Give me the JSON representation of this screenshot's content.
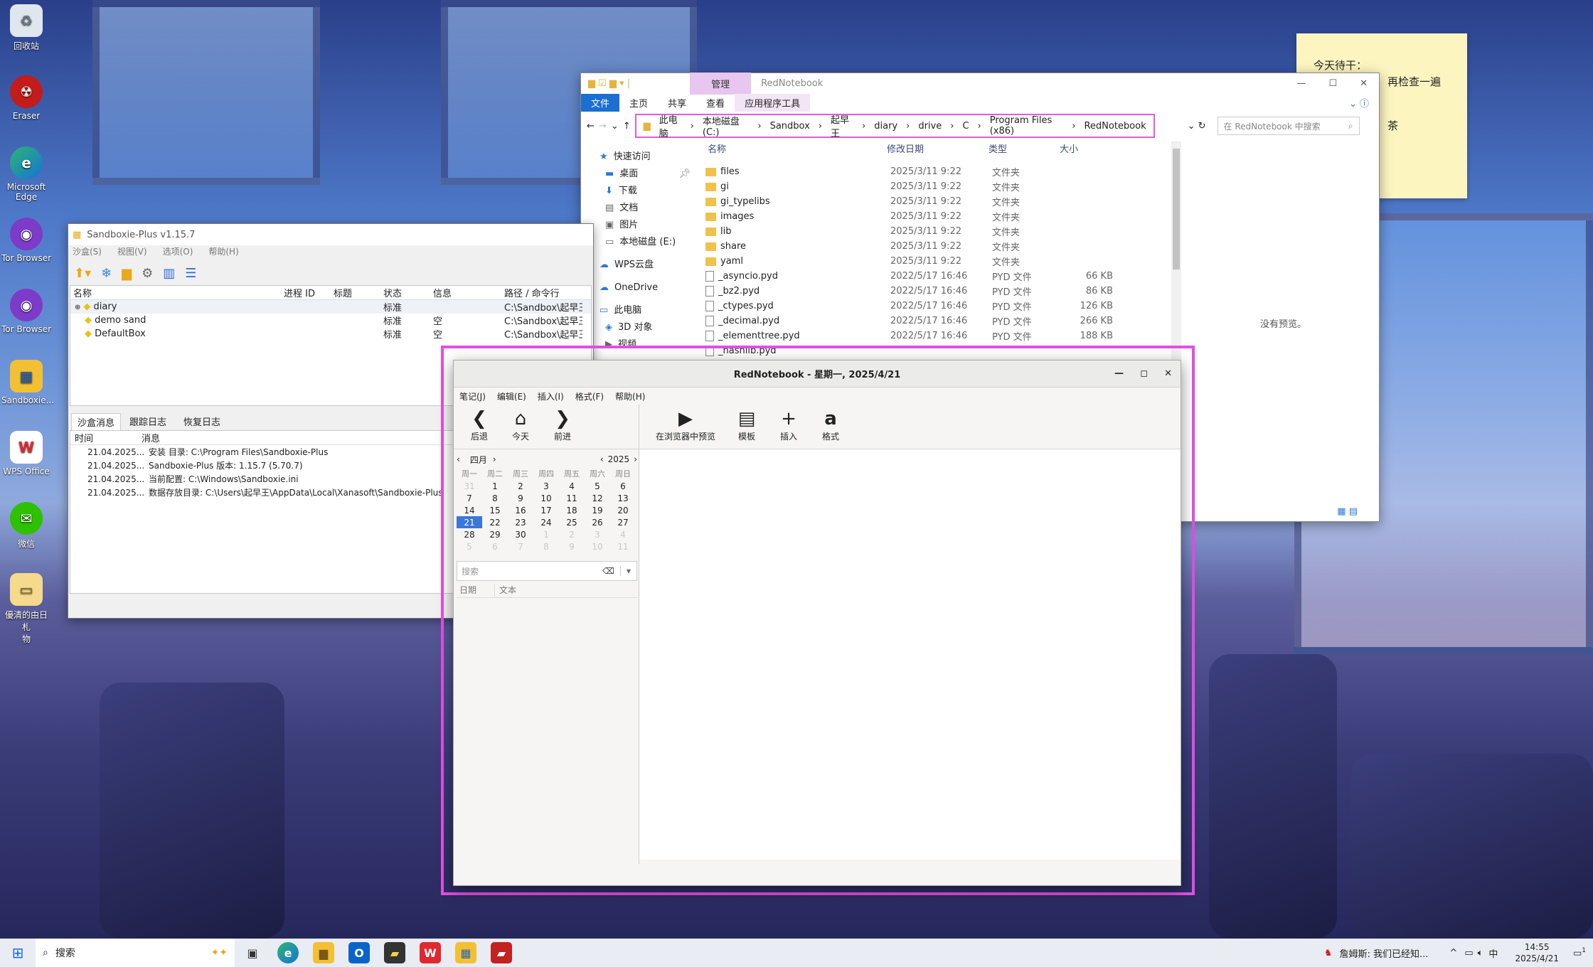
{
  "desktop": {
    "icons": [
      {
        "label": "回收站",
        "icon": "recycle-bin-icon"
      },
      {
        "label": "Eraser",
        "icon": "eraser-icon"
      },
      {
        "label": "Microsoft Edge",
        "icon": "edge-icon"
      },
      {
        "label": "Tor Browser",
        "icon": "tor-browser-icon"
      },
      {
        "label": "Tor Browser",
        "icon": "tor-browser-icon"
      },
      {
        "label": "Sandboxie...",
        "icon": "sandboxie-icon"
      },
      {
        "label": "WPS Office",
        "icon": "wps-office-icon"
      },
      {
        "label": "微信",
        "icon": "wechat-icon"
      },
      {
        "label": "優清的由日札\n物",
        "icon": "folder-icon"
      }
    ]
  },
  "sticky": {
    "lines": [
      "今天待干：",
      "再检查一遍",
      "",
      "茶"
    ]
  },
  "explorer": {
    "ribbon_tools": "管理",
    "title": "RedNotebook",
    "tabs": [
      "文件",
      "主页",
      "共享",
      "查看",
      "应用程序工具"
    ],
    "breadcrumb": [
      "此电脑",
      "本地磁盘 (C:)",
      "Sandbox",
      "起早王",
      "diary",
      "drive",
      "C",
      "Program Files (x86)",
      "RedNotebook"
    ],
    "search_placeholder": "在 RedNotebook 中搜索",
    "nav": [
      "快速访问",
      "桌面",
      "下载",
      "文档",
      "图片",
      "本地磁盘 (E:)",
      "WPS云盘",
      "OneDrive",
      "此电脑",
      "3D 对象",
      "视频"
    ],
    "columns": [
      "名称",
      "修改日期",
      "类型",
      "大小"
    ],
    "files": [
      {
        "name": "files",
        "date": "2025/3/11 9:22",
        "type": "文件夹",
        "size": "",
        "kind": "folder"
      },
      {
        "name": "gi",
        "date": "2025/3/11 9:22",
        "type": "文件夹",
        "size": "",
        "kind": "folder"
      },
      {
        "name": "gi_typelibs",
        "date": "2025/3/11 9:22",
        "type": "文件夹",
        "size": "",
        "kind": "folder"
      },
      {
        "name": "images",
        "date": "2025/3/11 9:22",
        "type": "文件夹",
        "size": "",
        "kind": "folder"
      },
      {
        "name": "lib",
        "date": "2025/3/11 9:22",
        "type": "文件夹",
        "size": "",
        "kind": "folder"
      },
      {
        "name": "share",
        "date": "2025/3/11 9:22",
        "type": "文件夹",
        "size": "",
        "kind": "folder"
      },
      {
        "name": "yaml",
        "date": "2025/3/11 9:22",
        "type": "文件夹",
        "size": "",
        "kind": "folder"
      },
      {
        "name": "_asyncio.pyd",
        "date": "2022/5/17 16:46",
        "type": "PYD 文件",
        "size": "66 KB",
        "kind": "pyd"
      },
      {
        "name": "_bz2.pyd",
        "date": "2022/5/17 16:46",
        "type": "PYD 文件",
        "size": "86 KB",
        "kind": "pyd"
      },
      {
        "name": "_ctypes.pyd",
        "date": "2022/5/17 16:46",
        "type": "PYD 文件",
        "size": "126 KB",
        "kind": "pyd"
      },
      {
        "name": "_decimal.pyd",
        "date": "2022/5/17 16:46",
        "type": "PYD 文件",
        "size": "266 KB",
        "kind": "pyd"
      },
      {
        "name": "_elementtree.pyd",
        "date": "2022/5/17 16:46",
        "type": "PYD 文件",
        "size": "188 KB",
        "kind": "pyd"
      },
      {
        "name": "_hashlib.pyd",
        "date": "",
        "type": "",
        "size": "",
        "kind": "pyd"
      }
    ],
    "preview": "没有预览。"
  },
  "sandboxie": {
    "title": "Sandboxie-Plus v1.15.7",
    "menu": [
      "沙盒(S)",
      "视图(V)",
      "选项(O)",
      "帮助(H)"
    ],
    "columns": [
      "名称",
      "进程 ID",
      "标题",
      "状态",
      "信息",
      "路径 / 命令行"
    ],
    "boxes": [
      {
        "name": "diary",
        "status": "标准",
        "info": "",
        "path": "C:\\Sandbox\\起早王"
      },
      {
        "name": "demo sand",
        "status": "标准",
        "info": "空",
        "path": "C:\\Sandbox\\起早王"
      },
      {
        "name": "DefaultBox",
        "status": "标准",
        "info": "空",
        "path": "C:\\Sandbox\\起早王"
      }
    ],
    "log_tabs": [
      "沙盒消息",
      "跟踪日志",
      "恢复日志"
    ],
    "log_columns": [
      "时间",
      "消息"
    ],
    "log": [
      {
        "time": "21.04.2025...",
        "msg": "安装 目录: C:\\Program Files\\Sandboxie-Plus"
      },
      {
        "time": "21.04.2025...",
        "msg": "Sandboxie-Plus 版本: 1.15.7 (5.70.7)"
      },
      {
        "time": "21.04.2025...",
        "msg": "当前配置: C:\\Windows\\Sandboxie.ini"
      },
      {
        "time": "21.04.2025...",
        "msg": "数据存放目录: C:\\Users\\起早王\\AppData\\Local\\Xanasoft\\Sandboxie-Plus"
      }
    ]
  },
  "rednotebook": {
    "title": "RedNotebook - 星期一, 2025/4/21",
    "menu": [
      "笔记(J)",
      "编辑(E)",
      "插入(I)",
      "格式(F)",
      "帮助(H)"
    ],
    "toolbar": [
      {
        "glyph": "❮",
        "label": "后退",
        "icon": "back-icon"
      },
      {
        "glyph": "⌂",
        "label": "今天",
        "icon": "home-icon"
      },
      {
        "glyph": "❯",
        "label": "前进",
        "icon": "forward-icon"
      },
      {
        "glyph": "▶",
        "label": "在浏览器中预览",
        "icon": "preview-icon"
      },
      {
        "glyph": "▤",
        "label": "模板",
        "icon": "template-icon"
      },
      {
        "glyph": "+",
        "label": "插入",
        "icon": "insert-icon"
      },
      {
        "glyph": "a",
        "label": "格式",
        "icon": "format-icon"
      }
    ],
    "calendar": {
      "month": "四月",
      "year": "2025",
      "weekdays": [
        "周一",
        "周二",
        "周三",
        "周四",
        "周五",
        "周六",
        "周日"
      ],
      "weeks": [
        [
          "31",
          "1",
          "2",
          "3",
          "4",
          "5",
          "6"
        ],
        [
          "7",
          "8",
          "9",
          "10",
          "11",
          "12",
          "13"
        ],
        [
          "14",
          "15",
          "16",
          "17",
          "18",
          "19",
          "20"
        ],
        [
          "21",
          "22",
          "23",
          "24",
          "25",
          "26",
          "27"
        ],
        [
          "28",
          "29",
          "30",
          "1",
          "2",
          "3",
          "4"
        ],
        [
          "5",
          "6",
          "7",
          "8",
          "9",
          "10",
          "11"
        ]
      ],
      "selected": "21"
    },
    "search_placeholder": "搜索",
    "results_columns": [
      "日期",
      "文本"
    ]
  },
  "taskbar": {
    "search": "搜索",
    "notification": "詹姆斯: 我们已经知...",
    "ime": "中",
    "time": "14:55",
    "date": "2025/4/21",
    "badge": "1"
  }
}
